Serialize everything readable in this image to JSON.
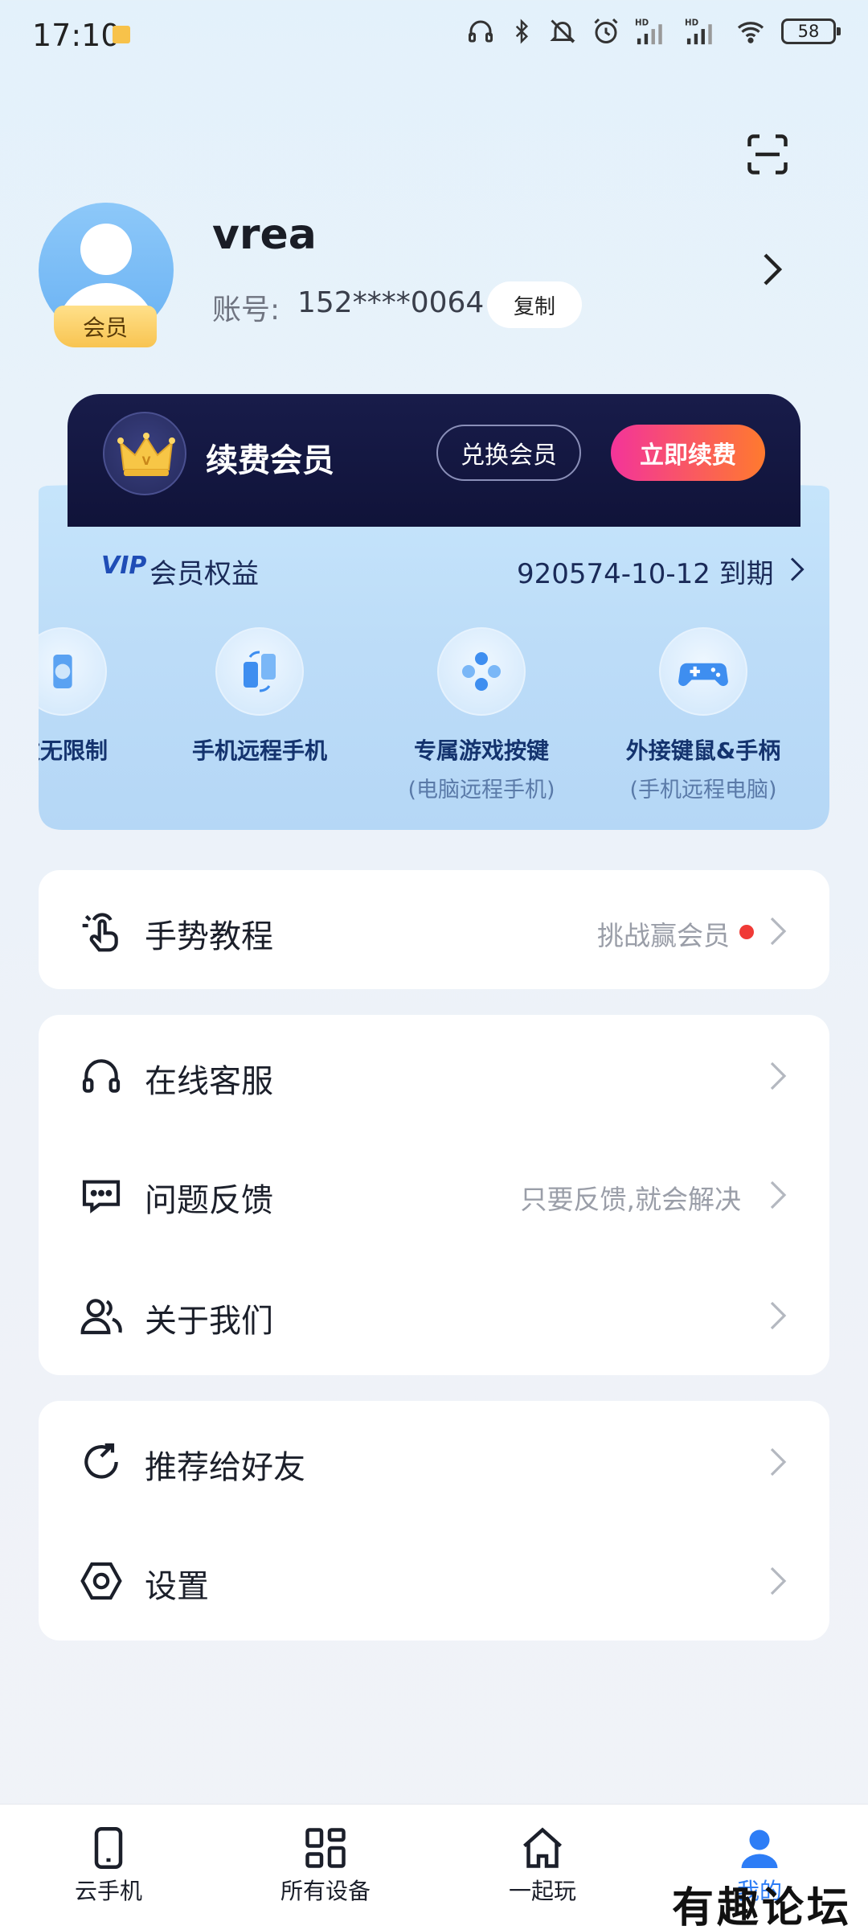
{
  "status_bar": {
    "time": "17:10",
    "battery": "58",
    "icons": [
      "headphones-icon",
      "bluetooth-icon",
      "mute-icon",
      "alarm-icon",
      "signal-hd-icon",
      "signal-hd-icon",
      "wifi-icon"
    ]
  },
  "profile": {
    "username": "vrea",
    "account_label": "账号:",
    "account_value": "152****0064",
    "copy_label": "复制",
    "member_badge": "会员"
  },
  "vip": {
    "title": "续费会员",
    "redeem_label": "兑换会员",
    "renew_label": "立即续费",
    "logo": "VIP",
    "benefits_label": "会员权益",
    "expiry": "920574-10-12 到期",
    "benefits": [
      {
        "label": "数无限制",
        "sub": "",
        "icon": "cloud-phone-icon"
      },
      {
        "label": "手机远程手机",
        "sub": "",
        "icon": "phone-to-phone-icon"
      },
      {
        "label": "专属游戏按键",
        "sub": "(电脑远程手机)",
        "icon": "game-keys-icon"
      },
      {
        "label": "外接键鼠&手柄",
        "sub": "(手机远程电脑)",
        "icon": "gamepad-icon"
      }
    ]
  },
  "menu": {
    "gesture": {
      "title": "手势教程",
      "hint": "挑战赢会员"
    },
    "support": {
      "title": "在线客服"
    },
    "feedback": {
      "title": "问题反馈",
      "hint": "只要反馈,就会解决"
    },
    "about": {
      "title": "关于我们"
    },
    "share": {
      "title": "推荐给好友"
    },
    "settings": {
      "title": "设置"
    }
  },
  "nav": {
    "items": [
      {
        "label": "云手机",
        "icon": "phone-icon"
      },
      {
        "label": "所有设备",
        "icon": "grid-icon"
      },
      {
        "label": "一起玩",
        "icon": "home-icon"
      },
      {
        "label": "我的",
        "icon": "person-icon"
      }
    ],
    "active_index": 3
  },
  "watermark": "有趣论坛",
  "colors": {
    "accent": "#2d7df6",
    "vip_dark": "#141845",
    "renew_gradient_start": "#f3349a",
    "renew_gradient_end": "#ff7a2e",
    "badge_red": "#f03a36"
  }
}
